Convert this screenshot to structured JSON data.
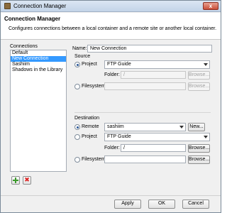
{
  "window": {
    "title": "Connection Manager",
    "close_glyph": "x"
  },
  "header": {
    "title": "Connection Manager",
    "description": "Configures connections between a local container and a remote site or another local container."
  },
  "connections": {
    "label": "Connections",
    "items": [
      "Default",
      "New Connection",
      "Sashiim",
      "Shadows in the Library"
    ],
    "selected_index": 1
  },
  "form": {
    "name_label": "Name:",
    "name_value": "New Connection",
    "source": {
      "label": "Source",
      "project_label": "Project",
      "project_selected": true,
      "project_value": "FTP Guide",
      "folder_label": "Folder:",
      "folder_value": "/",
      "browse_label": "Browse...",
      "filesystem_label": "Filesystem",
      "filesystem_value": "",
      "filesystem_browse_label": "Browse..."
    },
    "destination": {
      "label": "Destination",
      "remote_label": "Remote",
      "remote_selected": true,
      "remote_value": "sashiim",
      "new_label": "New...",
      "project_label": "Project",
      "project_value": "FTP Guide",
      "folder_label": "Folder:",
      "folder_value": "/",
      "browse_label": "Browse...",
      "filesystem_label": "Filesystem",
      "filesystem_value": "",
      "filesystem_browse_label": "Browse..."
    }
  },
  "list_buttons": {
    "add_icon": "add-icon",
    "remove_icon": "remove-icon",
    "remove_glyph": "✖"
  },
  "footer": {
    "apply_label": "Apply",
    "ok_label": "OK",
    "cancel_label": "Cancel"
  }
}
